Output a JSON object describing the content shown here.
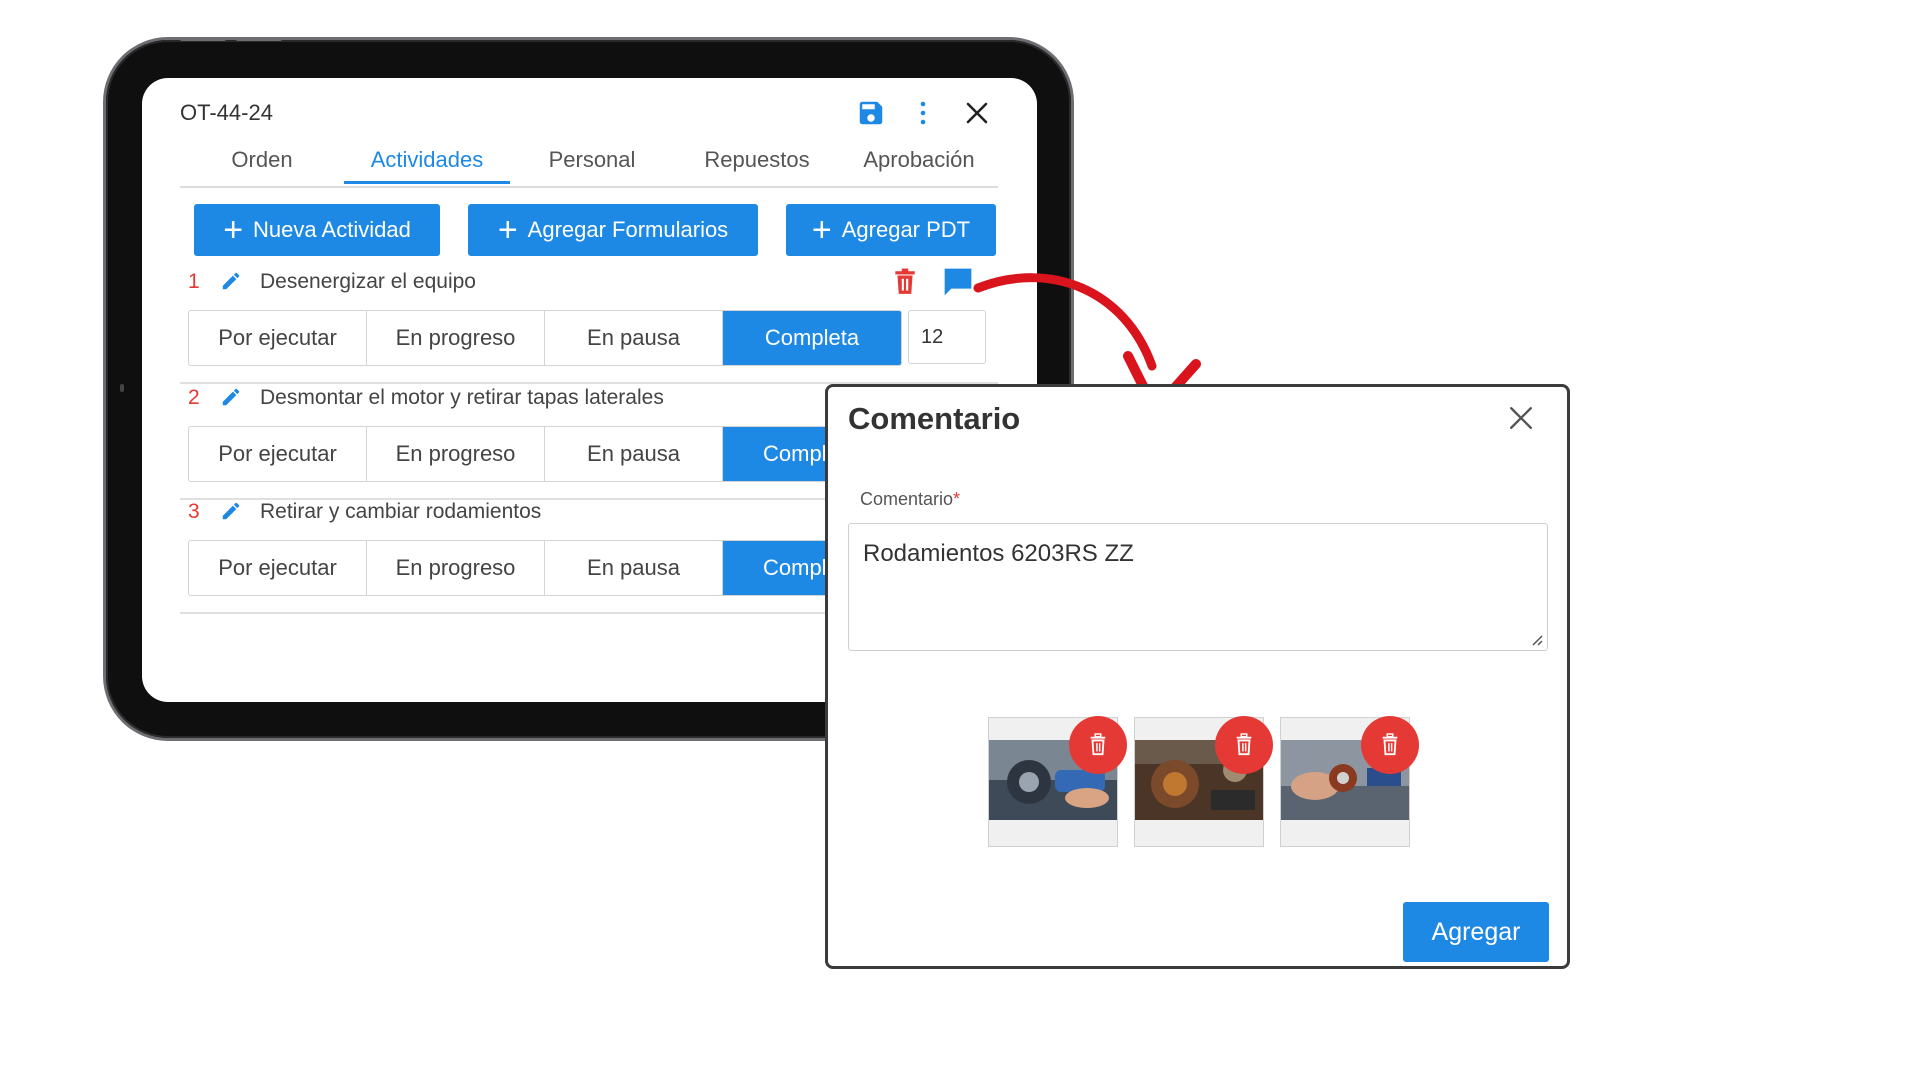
{
  "order": {
    "code": "OT-44-24"
  },
  "tabs": [
    {
      "label": "Orden"
    },
    {
      "label": "Actividades"
    },
    {
      "label": "Personal"
    },
    {
      "label": "Repuestos"
    },
    {
      "label": "Aprobación"
    }
  ],
  "actions": {
    "nueva": "Nueva Actividad",
    "formularios": "Agregar Formularios",
    "pdt": "Agregar PDT"
  },
  "status_options": [
    "Por ejecutar",
    "En progreso",
    "En pausa",
    "Completa"
  ],
  "status_truncated": "Compl",
  "activities": [
    {
      "num": "1",
      "title": "Desenergizar el equipo",
      "qty": "12"
    },
    {
      "num": "2",
      "title": "Desmontar el motor y retirar tapas laterales"
    },
    {
      "num": "3",
      "title": "Retirar y cambiar rodamientos"
    }
  ],
  "modal": {
    "title": "Comentario",
    "field_label": "Comentario",
    "required_mark": "*",
    "value": "Rodamientos 6203RS ZZ",
    "submit": "Agregar"
  },
  "colors": {
    "primary": "#1e88e5",
    "danger": "#e53935",
    "arrow": "#d9141c"
  }
}
